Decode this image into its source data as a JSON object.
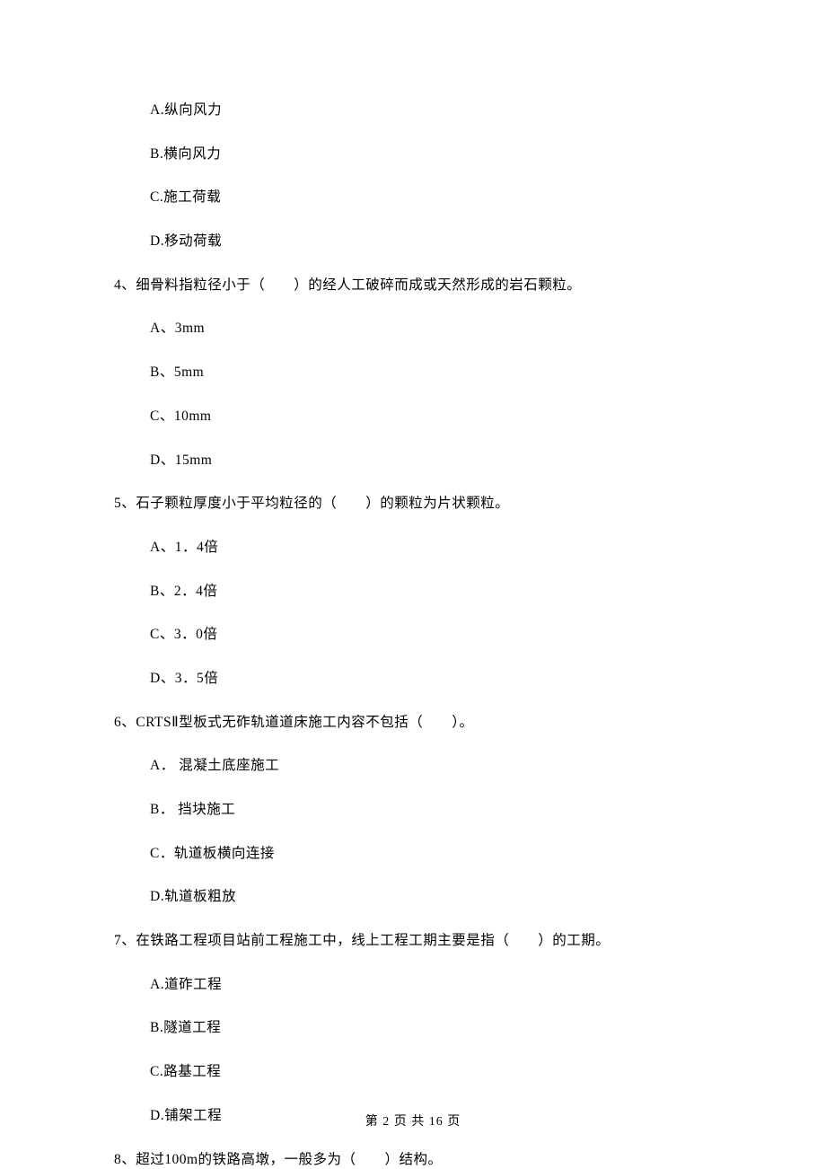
{
  "q3_options": {
    "a": "A.纵向风力",
    "b": "B.横向风力",
    "c": "C.施工荷载",
    "d": "D.移动荷载"
  },
  "q4": {
    "text": "4、细骨料指粒径小于（　　）的经人工破碎而成或天然形成的岩石颗粒。",
    "a": "A、3mm",
    "b": "B、5mm",
    "c": "C、10mm",
    "d": "D、15mm"
  },
  "q5": {
    "text": "5、石子颗粒厚度小于平均粒径的（　　）的颗粒为片状颗粒。",
    "a": "A、1．4倍",
    "b": "B、2．4倍",
    "c": "C、3．0倍",
    "d": "D、3．5倍"
  },
  "q6": {
    "text": "6、CRTSⅡ型板式无砟轨道道床施工内容不包括（　　）。",
    "a": "A． 混凝土底座施工",
    "b": "B． 挡块施工",
    "c": "C．轨道板横向连接",
    "d": "D.轨道板粗放"
  },
  "q7": {
    "text": "7、在铁路工程项目站前工程施工中，线上工程工期主要是指（　　）的工期。",
    "a": "A.道砟工程",
    "b": "B.隧道工程",
    "c": "C.路基工程",
    "d": "D.铺架工程"
  },
  "q8": {
    "text": "8、超过100m的铁路高墩，一般多为（　　）结构。"
  },
  "footer": "第 2 页 共 16 页"
}
